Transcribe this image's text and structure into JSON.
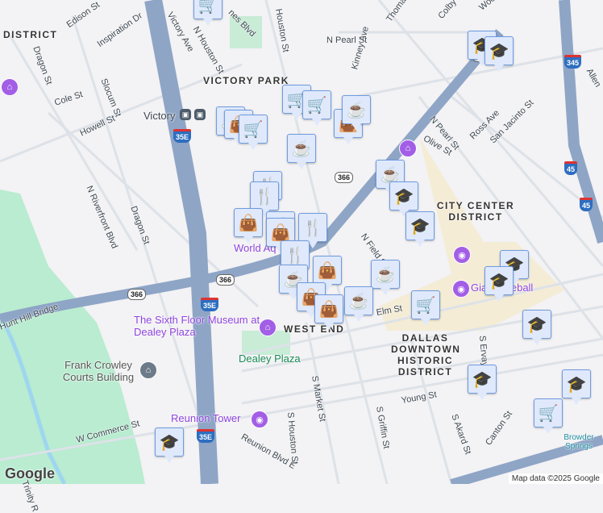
{
  "labels": {
    "district_top": "DISTRICT",
    "victory_park": "VICTORY PARK",
    "city_center": "CITY CENTER DISTRICT",
    "downtown_historic": "DALLAS DOWNTOWN HISTORIC DISTRICT",
    "west_end": "WEST END",
    "victory_station": "Victory"
  },
  "streets": [
    "Edison St",
    "Dragon St",
    "Inspiration Dr",
    "Victory Ave",
    "N Houston St",
    "nes Blvd",
    "Cole St",
    "Slocum St",
    "Howell St",
    "N Riverfront Blvd",
    "Dragon St",
    "N Pearl St",
    "Thomas Ave",
    "Colby St",
    "Woodall R",
    "Kinney Ave",
    "N Pearl St",
    "Ross Ave",
    "San Jacinto St",
    "Olive St",
    "N Field St",
    "Elm St",
    "S Ervay St",
    "Young St",
    "S Market St",
    "S Griffin St",
    "S Akard St",
    "Canton St",
    "W Commerce St",
    "Hunt Hill Bridge",
    "Reunion Blvd E",
    "S Houston St",
    "Trinity R",
    "Houston St",
    "Allen"
  ],
  "pois": {
    "sixth_floor": "The Sixth Floor Museum at Dealey Plaza",
    "world_aquarium": "World Aq",
    "reunion_tower": "Reunion Tower",
    "giant_eyeball": "Giant Eyeball",
    "dealey_plaza": "Dealey Plaza",
    "courts": "Frank Crowley Courts Building",
    "browder": "Browder Springs"
  },
  "shields": {
    "r366": "366",
    "i35e": "35E",
    "i345": "345",
    "i45": "45"
  },
  "markers": [
    "cart",
    "cart",
    "coffee",
    "bag",
    "cart",
    "coffee",
    "bag",
    "coffee",
    "utensils",
    "utensils",
    "bag",
    "utensils",
    "bag",
    "utensils",
    "utensils",
    "bag",
    "coffee",
    "coffee",
    "bag",
    "coffee",
    "bag",
    "coffee",
    "graduation-cap",
    "graduation-cap",
    "graduation-cap",
    "graduation-cap",
    "graduation-cap",
    "graduation-cap",
    "cart",
    "graduation-cap",
    "graduation-cap",
    "graduation-cap",
    "cart",
    "graduation-cap",
    "cart"
  ],
  "marker_glyphs": {
    "cart": "🛒",
    "coffee": "☕",
    "bag": "👜",
    "utensils": "🍴",
    "graduation-cap": "🎓"
  },
  "google_logo": "Google",
  "attribution": "Map data ©2025 Google"
}
